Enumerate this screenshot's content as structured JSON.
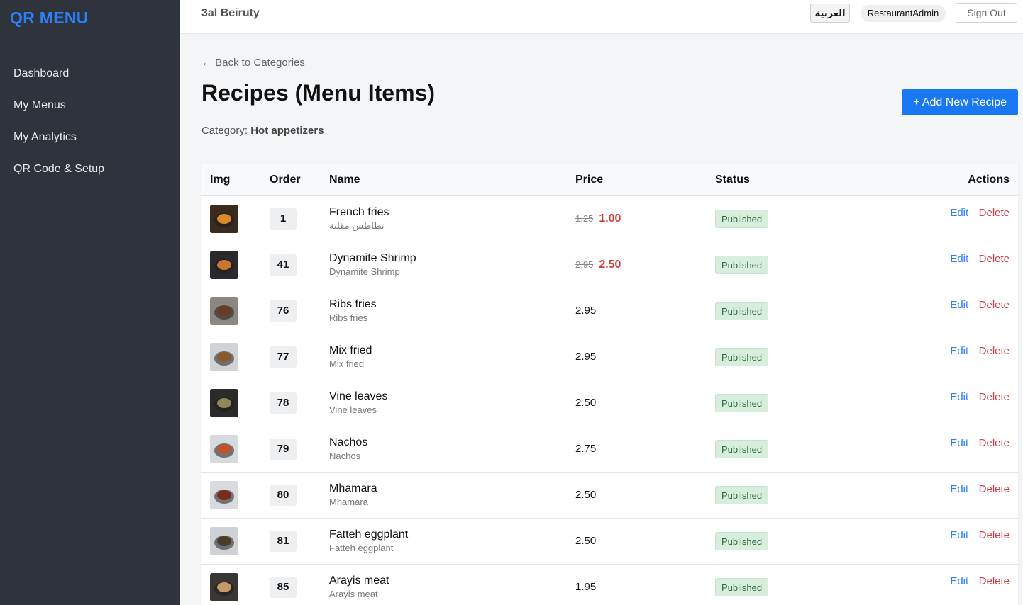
{
  "brand": {
    "title": "QR MENU",
    "color": "#2d7ff9"
  },
  "sidebar": {
    "items": [
      {
        "label": "Dashboard"
      },
      {
        "label": "My Menus"
      },
      {
        "label": "My Analytics"
      },
      {
        "label": "QR Code & Setup"
      }
    ]
  },
  "topbar": {
    "restaurant": "3al Beiruty",
    "language_button": "العربية",
    "user": "RestaurantAdmin",
    "signout": "Sign Out"
  },
  "page": {
    "back_link": "← Back to Categories",
    "title": "Recipes (Menu Items)",
    "category_label": "Category:",
    "category_name": "Hot appetizers",
    "add_button": "+ Add New Recipe"
  },
  "table": {
    "headers": {
      "img": "Img",
      "order": "Order",
      "name": "Name",
      "price": "Price",
      "status": "Status",
      "actions": "Actions"
    },
    "edit_label": "Edit",
    "delete_label": "Delete",
    "rows": [
      {
        "order": "1",
        "name": "French fries",
        "subname": "بطاطس مقلية",
        "old_price": "1.25",
        "price": "1.00",
        "status": "Published",
        "thumb": "fries",
        "discounted": true
      },
      {
        "order": "41",
        "name": "Dynamite Shrimp",
        "subname": "Dynamite Shrimp",
        "old_price": "2.95",
        "price": "2.50",
        "status": "Published",
        "thumb": "shrimp",
        "discounted": true
      },
      {
        "order": "76",
        "name": "Ribs fries",
        "subname": "Ribs fries",
        "price": "2.95",
        "status": "Published",
        "thumb": "ribs"
      },
      {
        "order": "77",
        "name": "Mix fried",
        "subname": "Mix fried",
        "price": "2.95",
        "status": "Published",
        "thumb": "mix"
      },
      {
        "order": "78",
        "name": "Vine leaves",
        "subname": "Vine leaves",
        "price": "2.50",
        "status": "Published",
        "thumb": "vine"
      },
      {
        "order": "79",
        "name": "Nachos",
        "subname": "Nachos",
        "price": "2.75",
        "status": "Published",
        "thumb": "nachos"
      },
      {
        "order": "80",
        "name": "Mhamara",
        "subname": "Mhamara",
        "price": "2.50",
        "status": "Published",
        "thumb": "mhamara"
      },
      {
        "order": "81",
        "name": "Fatteh eggplant",
        "subname": "Fatteh eggplant",
        "price": "2.50",
        "status": "Published",
        "thumb": "fatteh"
      },
      {
        "order": "85",
        "name": "Arayis meat",
        "subname": "Arayis meat",
        "price": "1.95",
        "status": "Published",
        "thumb": "arayis"
      }
    ]
  }
}
